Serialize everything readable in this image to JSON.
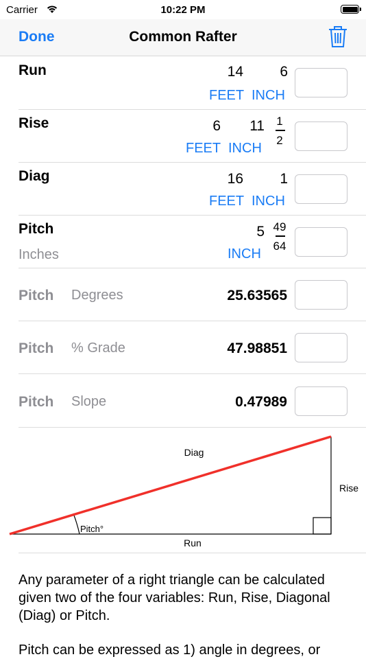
{
  "status_bar": {
    "carrier": "Carrier",
    "time": "10:22 PM"
  },
  "nav": {
    "done_label": "Done",
    "title": "Common Rafter"
  },
  "rows": {
    "run": {
      "label": "Run",
      "feet": "14",
      "inch": "6",
      "feet_unit": "FEET",
      "inch_unit": "INCH"
    },
    "rise": {
      "label": "Rise",
      "feet": "6",
      "inch": "11",
      "frac_num": "1",
      "frac_den": "2",
      "feet_unit": "FEET",
      "inch_unit": "INCH"
    },
    "diag": {
      "label": "Diag",
      "feet": "16",
      "inch": "1",
      "feet_unit": "FEET",
      "inch_unit": "INCH"
    },
    "pitch_inches": {
      "label": "Pitch",
      "sublabel": "Inches",
      "inch": "5",
      "frac_num": "49",
      "frac_den": "64",
      "inch_unit": "INCH"
    },
    "pitch_degrees": {
      "label": "Pitch",
      "sublabel": "Degrees",
      "value": "25.63565"
    },
    "pitch_grade": {
      "label": "Pitch",
      "sublabel": "% Grade",
      "value": "47.98851"
    },
    "pitch_slope": {
      "label": "Pitch",
      "sublabel": "Slope",
      "value": "0.47989"
    }
  },
  "diagram": {
    "diag_label": "Diag",
    "rise_label": "Rise",
    "run_label": "Run",
    "pitch_label": "Pitch°",
    "line_color": "#f0302a"
  },
  "description": {
    "para1": "Any parameter of a right triangle can be calculated given two of the four variables: Run, Rise, Diagonal (Diag) or Pitch.",
    "para2": "Pitch can be expressed as 1) angle in degrees, or"
  },
  "colors": {
    "accent": "#1a7cf5",
    "secondary_text": "#8e8e93"
  }
}
